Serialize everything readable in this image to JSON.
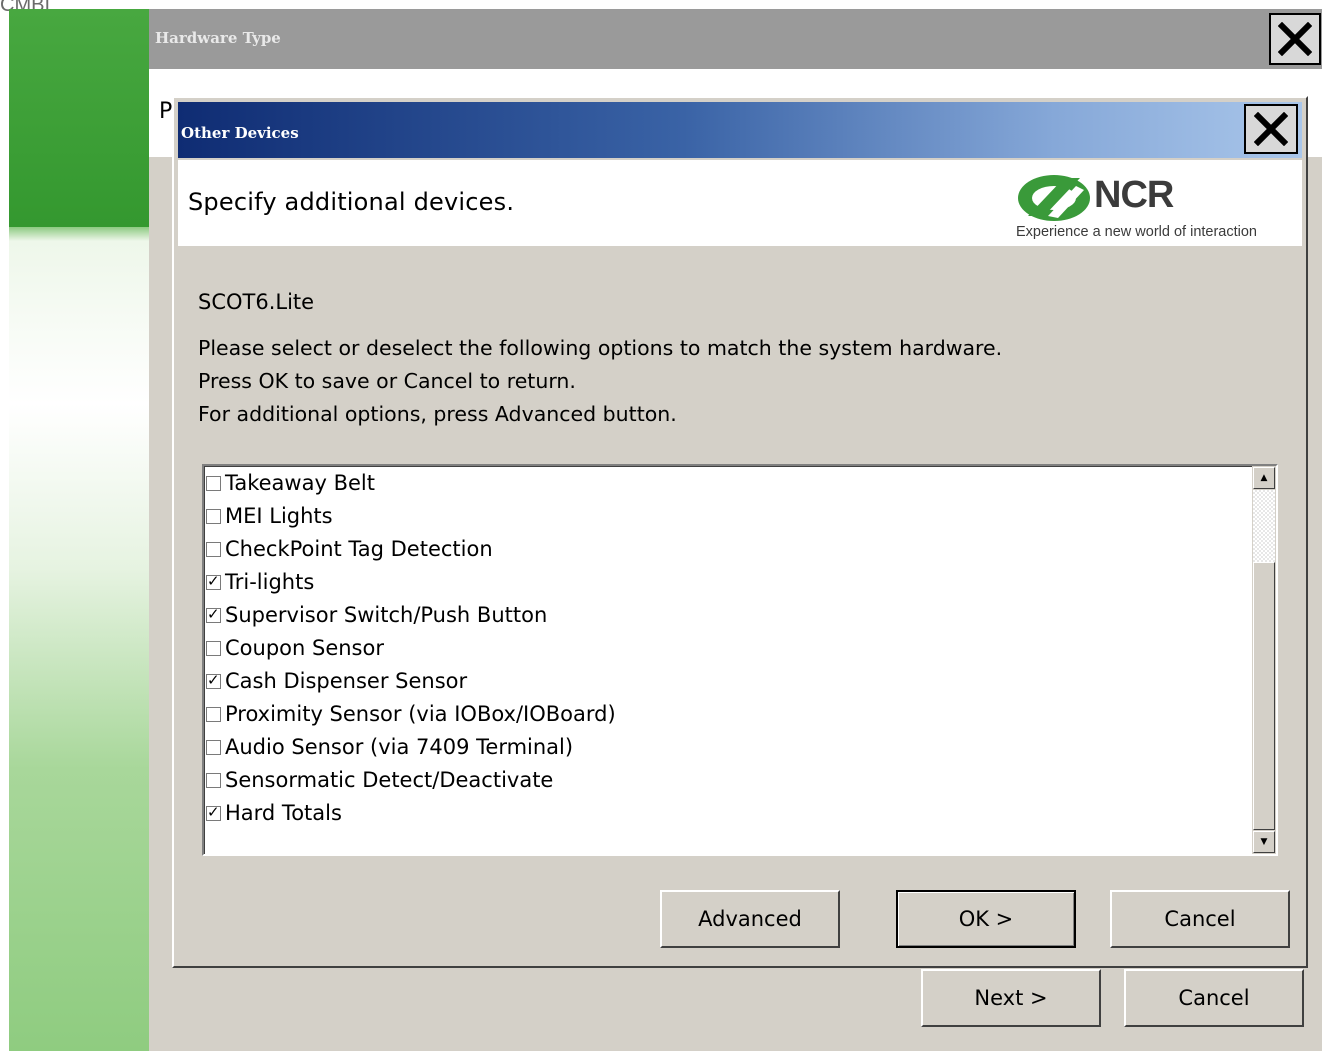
{
  "background": {
    "partial_text": "CMBI"
  },
  "outer_window": {
    "title": "Hardware Type",
    "header_partial_letter": "P",
    "next_label": "Next >",
    "cancel_label": "Cancel",
    "close_icon": "close-x-icon"
  },
  "dialog": {
    "title": "Other Devices",
    "header": "Specify additional devices.",
    "logo": {
      "word": "NCR",
      "tagline": "Experience a new world of interaction"
    },
    "model": "SCOT6.Lite",
    "instructions": [
      "Please select or deselect the following options to match the system hardware.",
      "Press OK to save or Cancel to return.",
      "For additional options, press Advanced button."
    ],
    "devices": [
      {
        "label": "Takeaway Belt",
        "checked": false
      },
      {
        "label": "MEI Lights",
        "checked": false
      },
      {
        "label": "CheckPoint Tag Detection",
        "checked": false
      },
      {
        "label": "Tri-lights",
        "checked": true
      },
      {
        "label": "Supervisor Switch/Push Button",
        "checked": true
      },
      {
        "label": "Coupon Sensor",
        "checked": false
      },
      {
        "label": "Cash Dispenser Sensor",
        "checked": true
      },
      {
        "label": "Proximity Sensor (via IOBox/IOBoard)",
        "checked": false
      },
      {
        "label": "Audio Sensor (via 7409 Terminal)",
        "checked": false
      },
      {
        "label": "Sensormatic Detect/Deactivate",
        "checked": false
      },
      {
        "label": "Hard Totals",
        "checked": true
      }
    ],
    "buttons": {
      "advanced": "Advanced",
      "ok": "OK >",
      "cancel": "Cancel"
    }
  },
  "colors": {
    "title_gradient_start": "#0f2c73",
    "title_gradient_end": "#a9c6ea",
    "dialog_face": "#d4d0c8",
    "logo_green": "#3a9a3a"
  }
}
